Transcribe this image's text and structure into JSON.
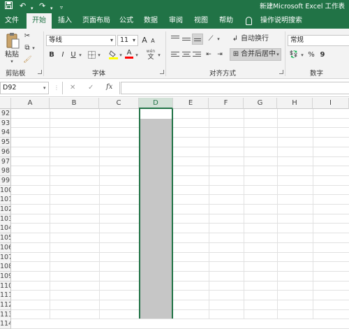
{
  "titlebar": {
    "title": "新建Microsoft Excel 工作表",
    "save_icon": "save-icon",
    "undo_icon": "undo-icon",
    "redo_icon": "redo-icon"
  },
  "tabs": [
    "文件",
    "开始",
    "插入",
    "页面布局",
    "公式",
    "数据",
    "审阅",
    "视图",
    "帮助"
  ],
  "tell_me": "操作说明搜索",
  "ribbon": {
    "clipboard": {
      "paste_label": "粘贴",
      "group_label": "剪贴板"
    },
    "font": {
      "font_name": "等线",
      "font_size": "11",
      "grow": "A",
      "shrink": "A",
      "bold": "B",
      "italic": "I",
      "underline": "U",
      "wen": "wén",
      "wen_char": "文",
      "font_color_letter": "A",
      "group_label": "字体"
    },
    "alignment": {
      "wrap_text": "自动换行",
      "merge_center": "合并后居中",
      "group_label": "对齐方式"
    },
    "number": {
      "format": "常规",
      "percent": "%",
      "comma": "9",
      "group_label": "数字"
    }
  },
  "formula_bar": {
    "name_box": "D92",
    "cancel": "✕",
    "enter": "✓",
    "fx": "fx",
    "value": ""
  },
  "columns": [
    "A",
    "B",
    "C",
    "D",
    "E",
    "F",
    "G",
    "H",
    "I"
  ],
  "selected_column": "D",
  "rows": [
    "92",
    "93",
    "94",
    "95",
    "96",
    "97",
    "98",
    "99",
    "100",
    "101",
    "102",
    "103",
    "104",
    "105",
    "106",
    "107",
    "108",
    "109",
    "110",
    "111",
    "112",
    "113",
    "114"
  ],
  "colors": {
    "excel_green": "#217346",
    "selection_gray": "#c6c6c6"
  }
}
